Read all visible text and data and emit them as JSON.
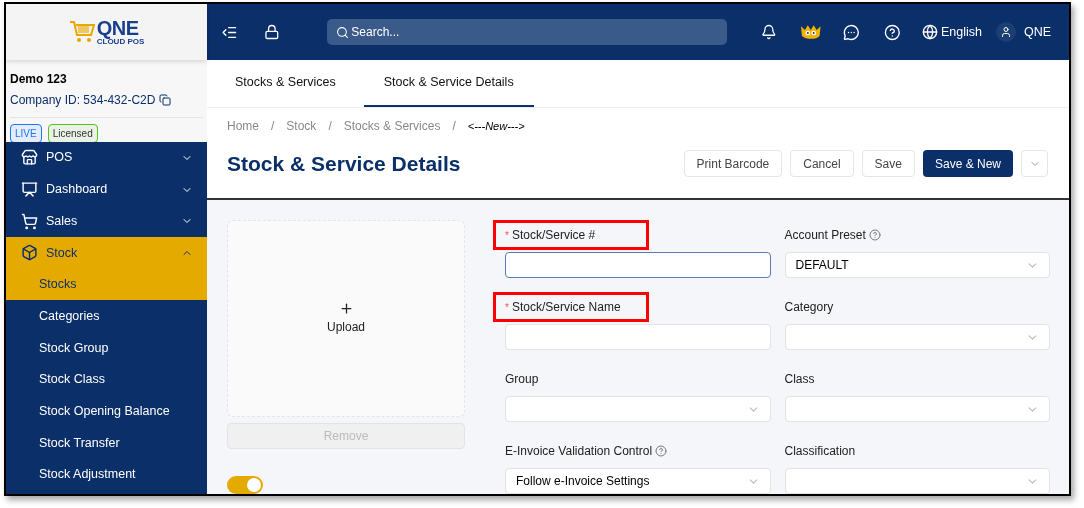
{
  "logo": {
    "name": "QNE",
    "tagline": "CLOUD POS"
  },
  "header": {
    "search": {
      "placeholder": "Search..."
    },
    "language": "English",
    "user": "QNE"
  },
  "company": {
    "name": "Demo 123",
    "id_text": "Company ID: 534-432-C2D",
    "badges": [
      {
        "label": "LIVE",
        "color": "#1677ff"
      },
      {
        "label": "Licensed",
        "color": "#52c41a"
      }
    ]
  },
  "sidebar": {
    "items": [
      {
        "label": "POS",
        "expanded": false,
        "selected": false
      },
      {
        "label": "Dashboard",
        "expanded": false,
        "selected": false
      },
      {
        "label": "Sales",
        "expanded": false,
        "selected": false
      },
      {
        "label": "Stock",
        "expanded": true,
        "selected": true,
        "children": [
          {
            "label": "Stocks",
            "selected": true
          },
          {
            "label": "Categories",
            "selected": false
          },
          {
            "label": "Stock Group",
            "selected": false
          },
          {
            "label": "Stock Class",
            "selected": false
          },
          {
            "label": "Stock Opening Balance",
            "selected": false
          },
          {
            "label": "Stock Transfer",
            "selected": false
          },
          {
            "label": "Stock Adjustment",
            "selected": false
          }
        ]
      }
    ]
  },
  "tabs": [
    {
      "label": "Stocks & Services",
      "selected": false
    },
    {
      "label": "Stock & Service Details",
      "selected": true
    }
  ],
  "breadcrumb_separator": "/",
  "required_mark": "*",
  "breadcrumb": [
    {
      "label": "Home",
      "current": false
    },
    {
      "label": "Stock",
      "current": false
    },
    {
      "label": "Stocks & Services",
      "current": false
    },
    {
      "label": "<---New--->",
      "current": true
    }
  ],
  "title": "Stock & Service Details",
  "actions": [
    {
      "kind": "default",
      "label": "Print Barcode"
    },
    {
      "kind": "default",
      "label": "Cancel"
    },
    {
      "kind": "default",
      "label": "Save"
    },
    {
      "kind": "primary",
      "label": "Save & New"
    },
    {
      "kind": "dropdown"
    }
  ],
  "upload": {
    "label": "Upload",
    "remove": {
      "label": "Remove",
      "disabled": true
    }
  },
  "toggle": {
    "on": true
  },
  "fields": [
    {
      "kind": "input",
      "label": "Stock/Service #",
      "required": true,
      "highlighted": true,
      "focused": true,
      "help": false
    },
    {
      "kind": "select",
      "label": "Account Preset",
      "required": false,
      "highlighted": false,
      "help": true,
      "value": "DEFAULT"
    },
    {
      "kind": "input",
      "label": "Stock/Service Name",
      "required": true,
      "highlighted": true,
      "focused": false,
      "help": false
    },
    {
      "kind": "select",
      "label": "Category",
      "required": false,
      "highlighted": false,
      "help": false
    },
    {
      "kind": "select",
      "label": "Group",
      "required": false,
      "highlighted": false,
      "help": false
    },
    {
      "kind": "select",
      "label": "Class",
      "required": false,
      "highlighted": false,
      "help": false
    },
    {
      "kind": "select",
      "label": "E-Invoice Validation Control",
      "required": false,
      "highlighted": false,
      "help": true,
      "value": "Follow e-Invoice Settings"
    },
    {
      "kind": "select",
      "label": "Classification",
      "required": false,
      "highlighted": false,
      "help": false
    }
  ]
}
